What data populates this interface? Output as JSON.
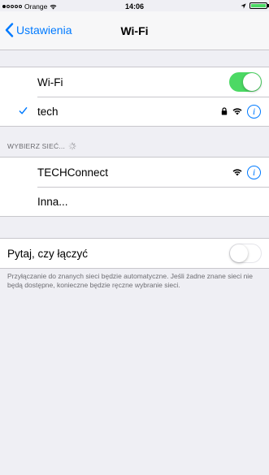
{
  "status_bar": {
    "carrier": "Orange",
    "time": "14:06"
  },
  "nav": {
    "back_label": "Ustawienia",
    "title": "Wi-Fi"
  },
  "wifi_group": {
    "wifi_label": "Wi-Fi",
    "wifi_on": true,
    "connected_network": "tech"
  },
  "networks_section": {
    "header": "WYBIERZ SIEĆ...",
    "networks": [
      {
        "name": "TECHConnect"
      }
    ],
    "other_label": "Inna..."
  },
  "ask_group": {
    "label": "Pytaj, czy łączyć",
    "on": false,
    "footer": "Przyłączanie do znanych sieci będzie automatyczne. Jeśli żadne znane sieci nie będą dostępne, konieczne będzie ręczne wybranie sieci."
  },
  "colors": {
    "accent": "#007aff",
    "toggle_on": "#4cd964",
    "background": "#efeff4"
  }
}
